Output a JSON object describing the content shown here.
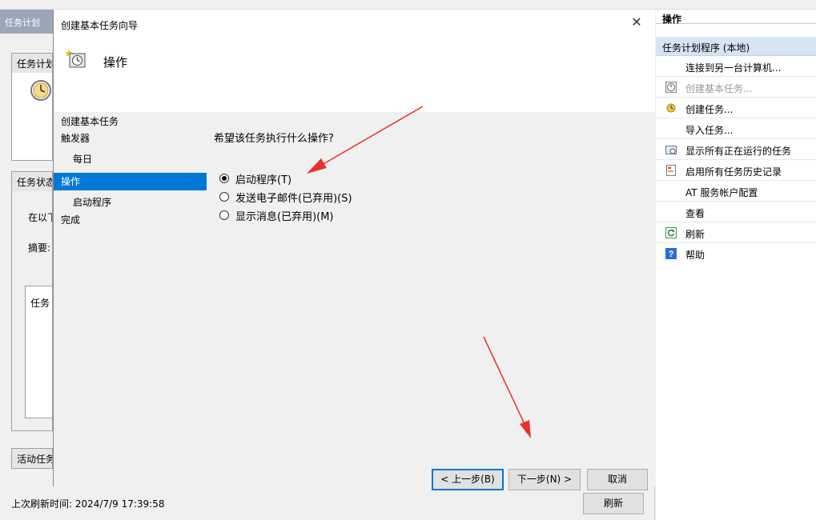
{
  "main": {
    "window_title_fragment": "任务计划",
    "group_titles": [
      "任务计划",
      "任务状态",
      "活动任务"
    ],
    "status_text_fragment": "在以下",
    "summary_label": "摘要:",
    "task_list_label": "任务",
    "last_refresh": "上次刷新时间: 2024/7/9 17:39:58",
    "refresh_button": "刷新"
  },
  "dialog": {
    "title": "创建基本任务向导",
    "close_symbol": "✕",
    "header_title": "操作",
    "steps": [
      {
        "label": "创建基本任务",
        "indent": false,
        "active": false
      },
      {
        "label": "触发器",
        "indent": false,
        "active": false
      },
      {
        "label": "每日",
        "indent": true,
        "active": false
      },
      {
        "label": "操作",
        "indent": false,
        "active": true
      },
      {
        "label": "启动程序",
        "indent": true,
        "active": false
      },
      {
        "label": "完成",
        "indent": false,
        "active": false
      }
    ],
    "question": "希望该任务执行什么操作?",
    "options": [
      {
        "label": "启动程序(T)",
        "checked": true
      },
      {
        "label": "发送电子邮件(已弃用)(S)",
        "checked": false
      },
      {
        "label": "显示消息(已弃用)(M)",
        "checked": false
      }
    ],
    "buttons": {
      "back": "< 上一步(B)",
      "next": "下一步(N) >",
      "cancel": "取消"
    }
  },
  "actions_pane": {
    "header": "操作",
    "section": "任务计划程序 (本地)",
    "items": [
      {
        "label": "连接到另一台计算机...",
        "icon": "none",
        "disabled": false
      },
      {
        "label": "创建基本任务...",
        "icon": "clock-wizard-icon",
        "disabled": true
      },
      {
        "label": "创建任务...",
        "icon": "clock-task-icon",
        "disabled": false
      },
      {
        "label": "导入任务...",
        "icon": "none",
        "disabled": false
      },
      {
        "label": "显示所有正在运行的任务",
        "icon": "running-tasks-icon",
        "disabled": false
      },
      {
        "label": "启用所有任务历史记录",
        "icon": "history-icon",
        "disabled": false
      },
      {
        "label": "AT 服务帐户配置",
        "icon": "none",
        "disabled": false
      },
      {
        "label": "查看",
        "icon": "none",
        "disabled": false
      },
      {
        "label": "刷新",
        "icon": "refresh-icon",
        "disabled": false
      },
      {
        "label": "帮助",
        "icon": "help-icon",
        "disabled": false
      }
    ]
  },
  "colors": {
    "accent": "#0078d7",
    "arrow": "#e8312a",
    "section_bg": "#d7e4f2"
  }
}
